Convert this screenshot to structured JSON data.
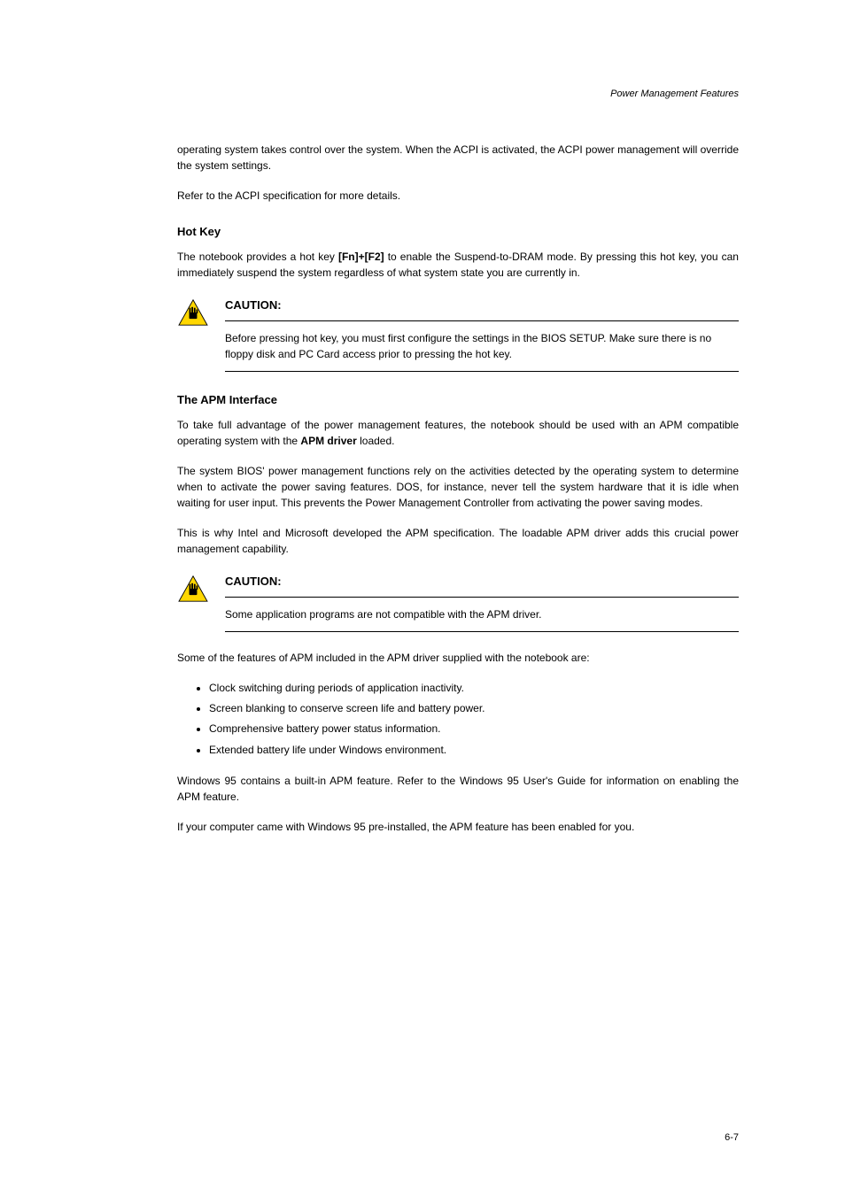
{
  "header": {
    "right": "Power Management Features"
  },
  "paragraphs": {
    "p1": "operating system takes control over the system. When the ACPI is activated, the ACPI power management will override the system settings.",
    "p2": "Refer to the ACPI specification for more details."
  },
  "heading1": "Hot Key",
  "p3_prefix": "The notebook provides a hot key ",
  "p3_bold": "[Fn]+[F2]",
  "p3_suffix": " to enable the Suspend-to-DRAM mode. By pressing this hot key, you can immediately suspend the system regardless of what system state you are currently in.",
  "caution1": {
    "label": "CAUTION:",
    "body": "Before pressing hot key, you must first configure the settings in the BIOS SETUP. Make sure there is no floppy disk and PC Card access prior to pressing the hot key."
  },
  "heading2": "The APM Interface",
  "p4_prefix": "To take full advantage of the power management features, the notebook should be used with an APM compatible operating system with the ",
  "p4_bold": "APM driver",
  "p4_suffix": " loaded.",
  "p5": "The system BIOS' power management functions rely on the activities detected by the operating system to determine when to activate the power saving features. DOS, for instance, never tell the system hardware that it is idle when waiting for user input. This prevents the Power Management Controller from activating the power saving modes.",
  "p6": "This is why Intel and Microsoft developed the APM specification. The loadable APM driver adds this crucial power management capability.",
  "caution2": {
    "label": "CAUTION:",
    "body": "Some application programs are not compatible with the APM driver."
  },
  "p7": "Some of the features of APM included in the APM driver supplied with the notebook are:",
  "bullets": [
    "Clock switching during periods of application inactivity.",
    "Screen blanking to conserve screen life and battery power.",
    "Comprehensive battery power status information.",
    "Extended battery life under Windows environment."
  ],
  "p8": "Windows 95 contains a built-in APM feature. Refer to the Windows 95 User's Guide for information on enabling the APM feature.",
  "p9": "If your computer came with Windows 95 pre-installed, the APM feature has been enabled for you.",
  "page_number": "6-7"
}
